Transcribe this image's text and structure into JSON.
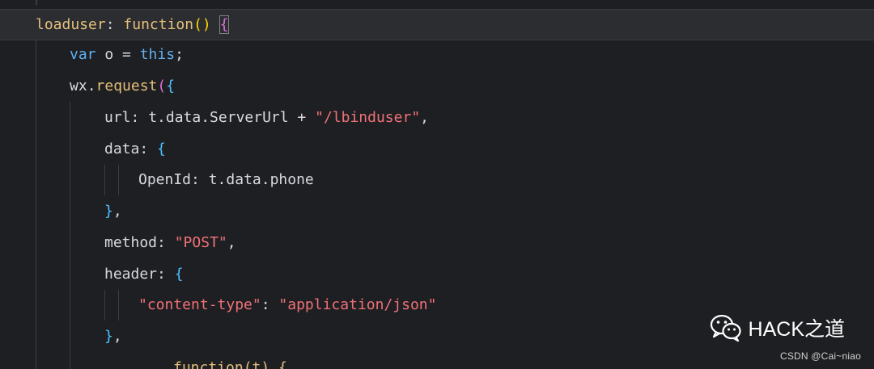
{
  "lines": {
    "l1": {
      "key": "loaduser",
      "sep": ": ",
      "fn": "function",
      "parens": "()",
      "space": " ",
      "brace": "{"
    },
    "l2": {
      "kw": "var",
      "name": " o = ",
      "this": "this",
      "semi": ";"
    },
    "l3": {
      "obj": "wx",
      "dot": ".",
      "method": "request",
      "paren": "(",
      "brace": "{"
    },
    "l4": {
      "key": "url",
      "sep": ": ",
      "value": "t.data.ServerUrl",
      "plus": " + ",
      "str": "\"/lbinduser\"",
      "comma": ","
    },
    "l5": {
      "key": "data",
      "sep": ": ",
      "brace": "{"
    },
    "l6": {
      "key": "OpenId",
      "sep": ": ",
      "value": "t.data.phone"
    },
    "l7": {
      "brace": "}",
      "comma": ","
    },
    "l8": {
      "key": "method",
      "sep": ": ",
      "str": "\"POST\"",
      "comma": ","
    },
    "l9": {
      "key": "header",
      "sep": ": ",
      "brace": "{"
    },
    "l10": {
      "str1": "\"content-type\"",
      "sep": ": ",
      "str2": "\"application/json\""
    },
    "l11": {
      "brace": "}",
      "comma": ","
    },
    "l12": {
      "partial": "function(t) {"
    }
  },
  "watermark": {
    "icon": "wechat-icon",
    "text": "HACK之道"
  },
  "credit": "CSDN @Cai~niao",
  "colors": {
    "background": "#1e1f22",
    "string": "#f07178",
    "keyword": "#61afef",
    "function": "#e5c07b"
  }
}
